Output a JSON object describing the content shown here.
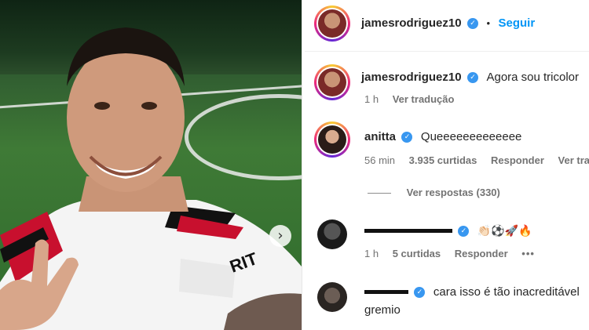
{
  "header": {
    "username": "jamesrodriguez10",
    "dot": "•",
    "follow_label": "Seguir"
  },
  "caption": {
    "username": "jamesrodriguez10",
    "text": "Agora sou tricolor",
    "time": "1 h",
    "translate": "Ver tradução"
  },
  "comments": [
    {
      "username": "anitta",
      "text": "Queeeeeeeeeeeee",
      "time": "56 min",
      "likes": "3.935 curtidas",
      "reply": "Responder",
      "translate": "Ver tra"
    },
    {
      "username": "",
      "text": "👏🏻⚽🚀🔥",
      "time": "1 h",
      "likes": "5 curtidas",
      "reply": "Responder",
      "more": "•••"
    },
    {
      "username": "",
      "text": "cara isso é tão inacreditável",
      "text2": "gremio"
    }
  ],
  "view_replies": "Ver respostas (330)",
  "next_arrow": "›",
  "verified_mark": "✓"
}
